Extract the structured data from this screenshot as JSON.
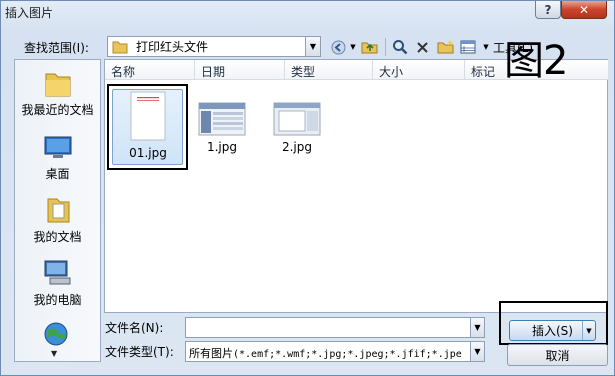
{
  "window": {
    "title": "插入图片",
    "help_label": "?",
    "close_label": "✕"
  },
  "toolbar": {
    "look_in_label": "查找范围(I):",
    "look_in_value": "打印红头文件",
    "tools_label": "工具(L)",
    "icons": [
      "back-icon",
      "up-folder-icon",
      "search-web-icon",
      "delete-icon",
      "new-folder-icon",
      "views-icon"
    ]
  },
  "overlay_label": "图2",
  "places": [
    {
      "label": "我最近的文档",
      "icon": "recent-documents-icon"
    },
    {
      "label": "桌面",
      "icon": "desktop-icon"
    },
    {
      "label": "我的文档",
      "icon": "my-documents-icon"
    },
    {
      "label": "我的电脑",
      "icon": "my-computer-icon"
    }
  ],
  "columns": [
    "名称",
    "日期",
    "类型",
    "大小",
    "标记"
  ],
  "files": [
    {
      "name": "01.jpg",
      "selected": true
    },
    {
      "name": "1.jpg",
      "selected": false
    },
    {
      "name": "2.jpg",
      "selected": false
    }
  ],
  "footer": {
    "file_name_label": "文件名(N):",
    "file_name_value": "",
    "file_type_label": "文件类型(T):",
    "file_type_prefix": "所有图片",
    "file_type_value": "(*.emf;*.wmf;*.jpg;*.jpeg;*.jfif;*.jpe",
    "insert_label": "插入(S)",
    "cancel_label": "取消"
  },
  "colors": {
    "accent": "#3c7fb1",
    "close": "#c9452c"
  }
}
